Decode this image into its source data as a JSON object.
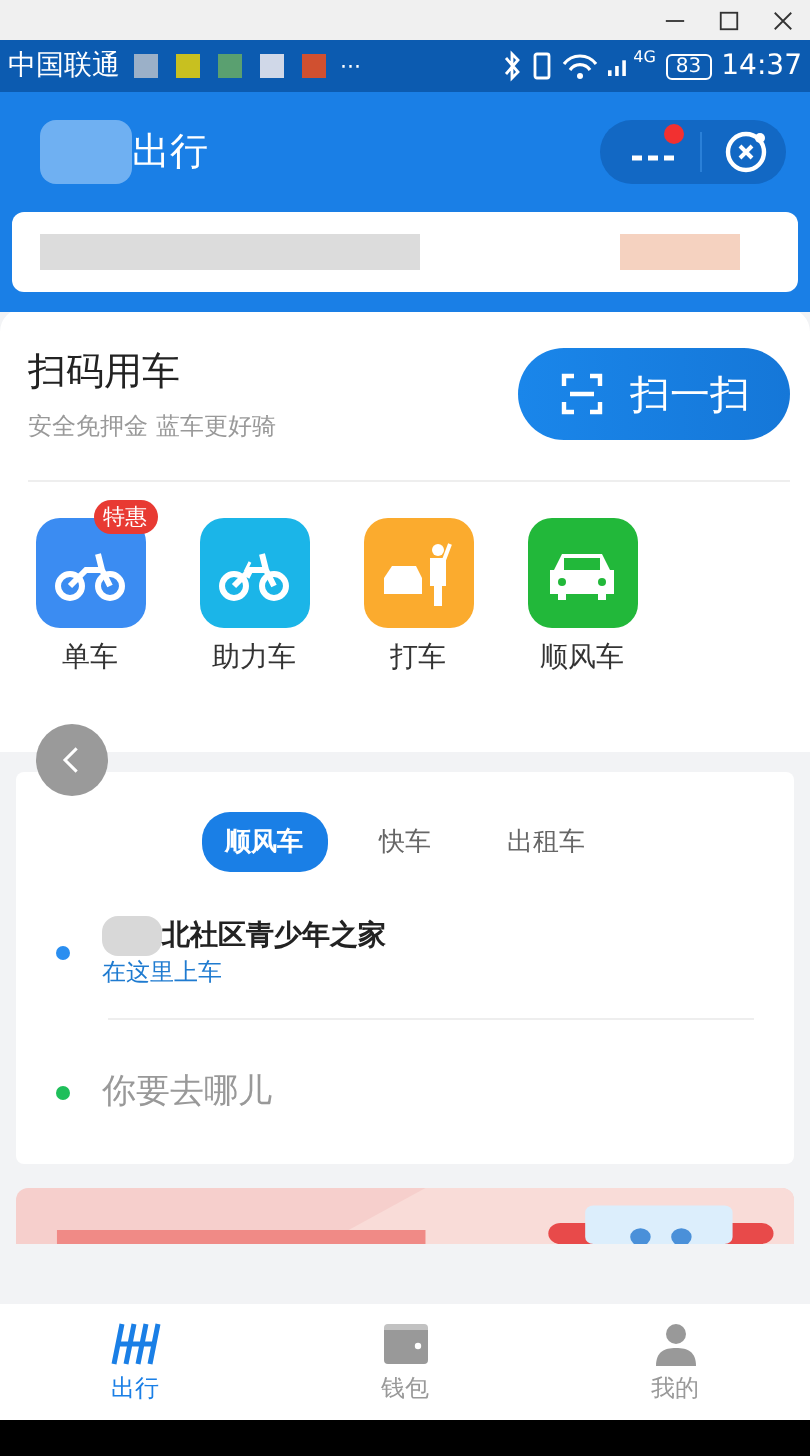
{
  "status_bar": {
    "carrier": "中国联通",
    "more": "···",
    "network": "4G",
    "battery": "83",
    "time": "14:37"
  },
  "header": {
    "title": "出行",
    "has_notification": true
  },
  "scan": {
    "title": "扫码用车",
    "subtitle": "安全免押金 蓝车更好骑",
    "button": "扫一扫"
  },
  "services": [
    {
      "label": "单车",
      "kind": "bike",
      "badge": "特惠"
    },
    {
      "label": "助力车",
      "kind": "ebike"
    },
    {
      "label": "打车",
      "kind": "taxi"
    },
    {
      "label": "顺风车",
      "kind": "car"
    }
  ],
  "ride_tabs": [
    {
      "label": "顺风车",
      "selected": true
    },
    {
      "label": "快车",
      "selected": false
    },
    {
      "label": "出租车",
      "selected": false
    }
  ],
  "pickup": {
    "name": "北社区青少年之家",
    "hint": "在这里上车"
  },
  "destination": {
    "placeholder": "你要去哪儿"
  },
  "nav": [
    {
      "label": "出行",
      "kind": "logo",
      "selected": true
    },
    {
      "label": "钱包",
      "kind": "wallet",
      "selected": false
    },
    {
      "label": "我的",
      "kind": "person",
      "selected": false
    }
  ]
}
